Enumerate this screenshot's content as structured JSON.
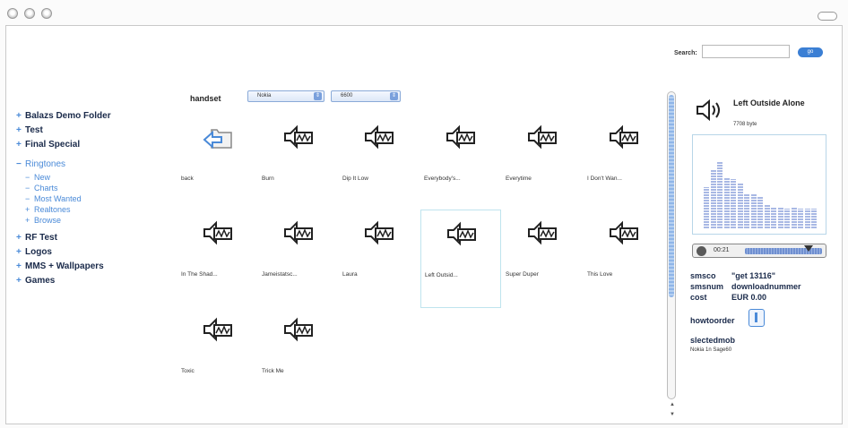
{
  "search": {
    "label": "Search:",
    "button": "go",
    "value": ""
  },
  "sidebar": {
    "items": [
      {
        "label": "Balazs Demo Folder",
        "marker": "+",
        "state": "collapsed"
      },
      {
        "label": "Test",
        "marker": "+",
        "state": "collapsed"
      },
      {
        "label": "Final Special",
        "marker": "+",
        "state": "collapsed"
      },
      {
        "label": "Ringtones",
        "marker": "−",
        "state": "expanded",
        "children": [
          {
            "label": "New",
            "marker": "−"
          },
          {
            "label": "Charts",
            "marker": "−"
          },
          {
            "label": "Most Wanted",
            "marker": "−"
          },
          {
            "label": "Realtones",
            "marker": "+"
          },
          {
            "label": "Browse",
            "marker": "+"
          }
        ]
      },
      {
        "label": "RF Test",
        "marker": "+",
        "state": "collapsed"
      },
      {
        "label": "Logos",
        "marker": "+",
        "state": "collapsed"
      },
      {
        "label": "MMS + Wallpapers",
        "marker": "+",
        "state": "collapsed"
      },
      {
        "label": "Games",
        "marker": "+",
        "state": "collapsed"
      }
    ]
  },
  "filters": {
    "label": "handset",
    "brand": "Nokia",
    "model": "6600"
  },
  "grid": {
    "items": [
      {
        "label": "back",
        "icon": "back-folder-icon"
      },
      {
        "label": "Burn",
        "icon": "ringtone-icon"
      },
      {
        "label": "Dip It Low",
        "icon": "ringtone-icon"
      },
      {
        "label": "Everybody's...",
        "icon": "ringtone-icon"
      },
      {
        "label": "Everytime",
        "icon": "ringtone-icon"
      },
      {
        "label": "I Don't Wan...",
        "icon": "ringtone-icon"
      },
      {
        "label": "In The Shad...",
        "icon": "ringtone-icon"
      },
      {
        "label": "Jameistatsc...",
        "icon": "ringtone-icon"
      },
      {
        "label": "Laura",
        "icon": "ringtone-icon"
      },
      {
        "label": "Left Outsid...",
        "icon": "ringtone-icon",
        "selected": true
      },
      {
        "label": "Super Duper",
        "icon": "ringtone-icon"
      },
      {
        "label": "This Love",
        "icon": "ringtone-icon"
      },
      {
        "label": "Toxic",
        "icon": "ringtone-icon"
      },
      {
        "label": "Trick Me",
        "icon": "ringtone-icon"
      }
    ]
  },
  "detail": {
    "title": "Left Outside Alone",
    "size": "7708 byte",
    "time": "00:21",
    "progress": 0.82,
    "levels": [
      0.5,
      0.72,
      0.82,
      0.62,
      0.6,
      0.55,
      0.42,
      0.42,
      0.38,
      0.28,
      0.25,
      0.25,
      0.24,
      0.25,
      0.24,
      0.24,
      0.24
    ],
    "sms_code_key": "smsco",
    "sms_code_value": "\"get 13116\"",
    "sms_num_key": "smsnum",
    "sms_num_value": "downloadnummer",
    "cost_key": "cost",
    "cost_value": "EUR 0.00",
    "how_to_order": "howtoorder",
    "selected_label": "slectedmob",
    "selected_model": "Nokia 1n Sage60"
  },
  "colors": {
    "accent": "#4a8ad8",
    "navText": "#1a2a4a",
    "button": "#3b7fd4"
  }
}
